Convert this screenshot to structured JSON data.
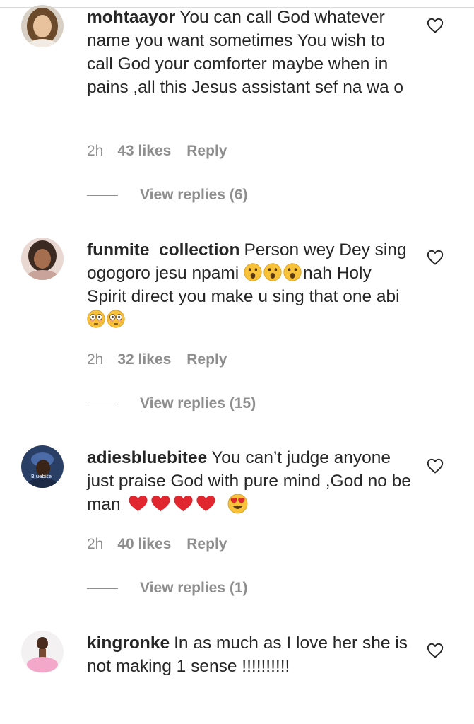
{
  "comments": [
    {
      "username": "mohtaayor",
      "text": "You can call God whatever name you want sometimes You wish to call God your comforter maybe when in pains ,all this Jesus assistant sef na wa o",
      "time": "2h",
      "likes": "43 likes",
      "reply_label": "Reply",
      "view_replies": "View replies (6)"
    },
    {
      "username": "funmite_collection",
      "text_part1": "Person wey Dey sing ogogoro jesu npami",
      "text_part2": "nah Holy Spirit direct you make u sing that one abi",
      "time": "2h",
      "likes": "32 likes",
      "reply_label": "Reply",
      "view_replies": "View replies (15)"
    },
    {
      "username": "adiesbluebitee",
      "text": "You can’t judge anyone just praise God with pure mind ,God no be man",
      "avatar_caption": "Bluebite",
      "time": "2h",
      "likes": "40 likes",
      "reply_label": "Reply",
      "view_replies": "View replies (1)"
    },
    {
      "username": "kingronke",
      "text": "In as much as I love her she is not making 1 sense !!!!!!!!!!"
    }
  ],
  "icons": {
    "like": "heart-outline-icon",
    "surprised": "hushed-face-emoji",
    "flushed": "flushed-face-emoji",
    "red_heart": "red-heart-emoji",
    "heart_eyes": "heart-eyes-emoji"
  },
  "colors": {
    "text": "#262626",
    "secondary": "#8e8e8e",
    "divider": "#dbdbdb",
    "heart_red": "#e0262f",
    "emoji_yellow": "#f7c23a"
  }
}
